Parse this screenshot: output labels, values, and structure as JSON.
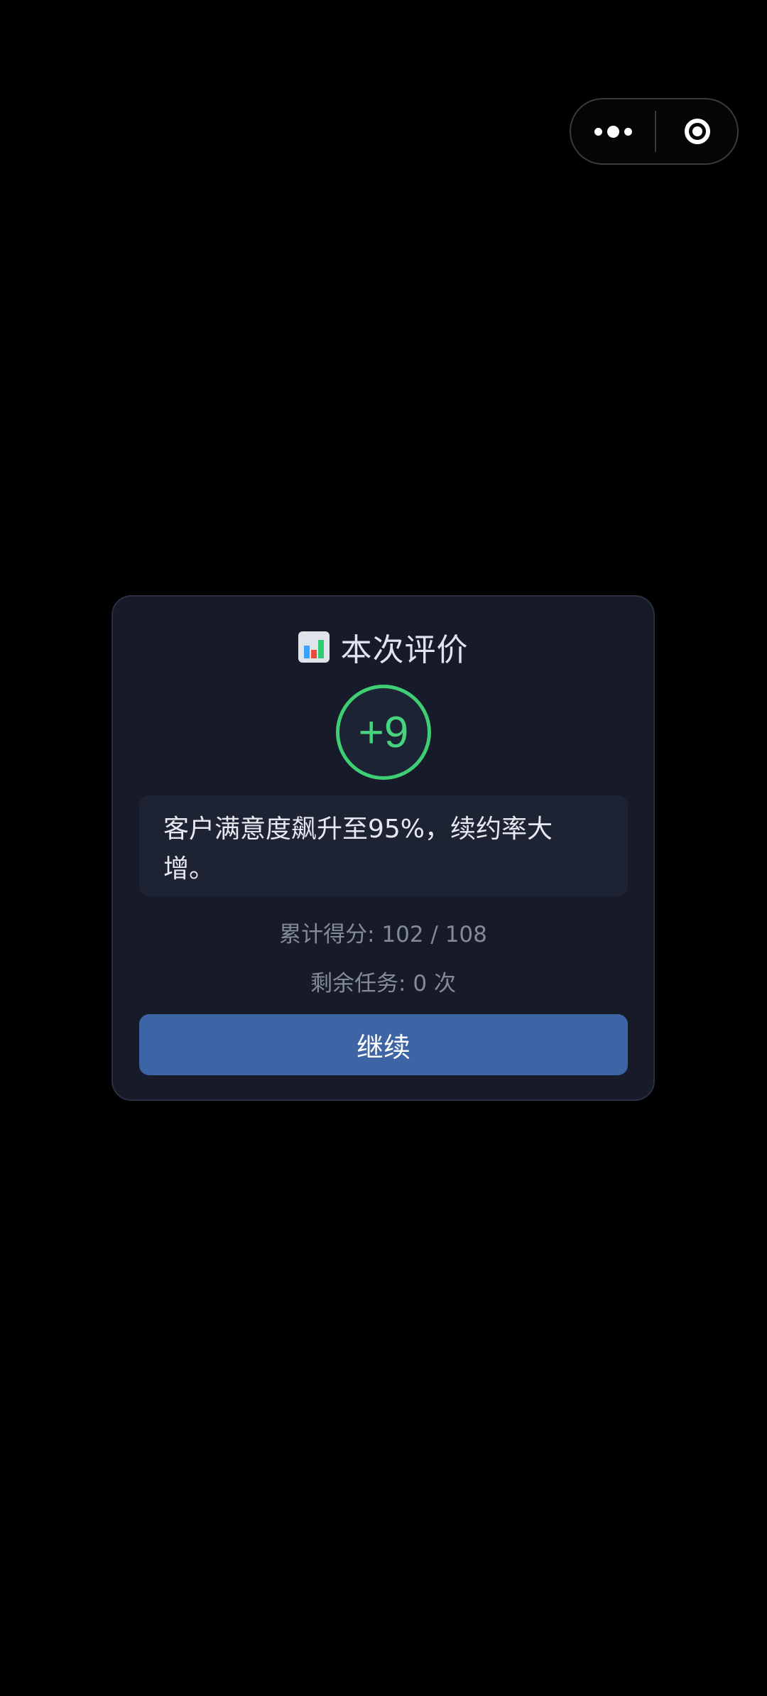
{
  "capsule": {
    "more_icon": "more-dots-icon",
    "close_icon": "record-circle-icon"
  },
  "modal": {
    "icon": "bar-chart-icon",
    "title": "本次评价",
    "score": "+9",
    "description": "客户满意度飙升至95%，续约率大增。",
    "total_label": "累计得分: 102 / 108",
    "remaining_label": "剩余任务: 0 次",
    "continue_label": "继续",
    "colors": {
      "background": "#161a29",
      "score_ring": "#3ecf74",
      "button": "#3d64a4"
    }
  }
}
